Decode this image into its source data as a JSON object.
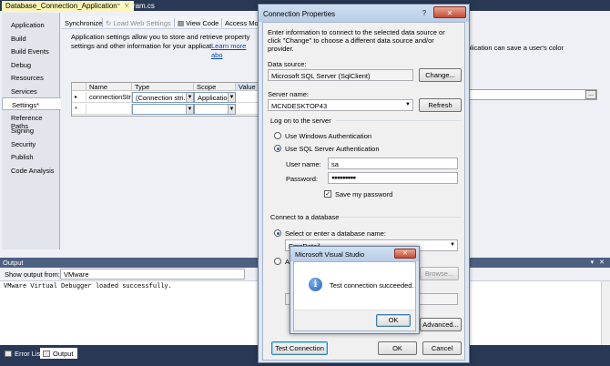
{
  "doc_tabs": [
    {
      "label": "Database_Connection_Application*",
      "close": "✕"
    },
    {
      "label": "Program.cs"
    }
  ],
  "nav_items": [
    "Application",
    "Build",
    "Build Events",
    "Debug",
    "Resources",
    "Services",
    "Settings*",
    "Reference Paths",
    "Signing",
    "Security",
    "Publish",
    "Code Analysis"
  ],
  "settings_toolbar": {
    "synchronize": "Synchronize",
    "load_web": "Load Web Settings",
    "view_code": "View Code",
    "access": "Access Mod"
  },
  "settings_desc": {
    "text": "Application settings allow you to store and retrieve property settings and other information for your application dynamically. For example, the application can save a user's color preferences, then retrieve them the next time it runs.",
    "link": "Learn more abo"
  },
  "right_desc": {
    "line1": "plication can save a user's color"
  },
  "grid": {
    "headers": [
      "Name",
      "Type",
      "Scope",
      "Value"
    ],
    "row1": {
      "marker": "▸",
      "name": "connectionStr",
      "type": "(Connection stri...",
      "scope": "Application"
    },
    "row2_marker": "*"
  },
  "dots": "...",
  "output": {
    "title": "Output",
    "ctrl": "▾ ✕",
    "show_from_label": "Show output from:",
    "source": "VMware",
    "text": "VMware Virtual Debugger loaded successfully."
  },
  "bottom_tabs": [
    "Error List",
    "Output"
  ],
  "cp": {
    "title": "Connection Properties",
    "tbtn_help": "?",
    "tbtn_close": "✕",
    "intro": "Enter information to connect to the selected data source or click \"Change\" to choose a different data source and/or provider.",
    "data_source_label": "Data source:",
    "data_source": "Microsoft SQL Server (SqlClient)",
    "change": "Change...",
    "server_label": "Server name:",
    "server": "MCNDESKTOP43",
    "refresh": "Refresh",
    "logon_header": "Log on to the server",
    "win_auth": "Use Windows Authentication",
    "sql_auth": "Use SQL Server Authentication",
    "user_label": "User name:",
    "user": "sa",
    "pwd_label": "Password:",
    "pwd": "●●●●●●●●●",
    "save_pwd": "Save my password",
    "connect_header": "Connect to a database",
    "select_db": "Select or enter a database name:",
    "db": "EmpDetail",
    "attach_prefix": "At",
    "browse": "Browse...",
    "advanced": "Advanced...",
    "test": "Test Connection",
    "ok": "OK",
    "cancel": "Cancel"
  },
  "msgbox": {
    "title": "Microsoft Visual Studio",
    "close": "✕",
    "icon_glyph": "i",
    "message": "Test connection succeeded.",
    "ok": "OK"
  }
}
